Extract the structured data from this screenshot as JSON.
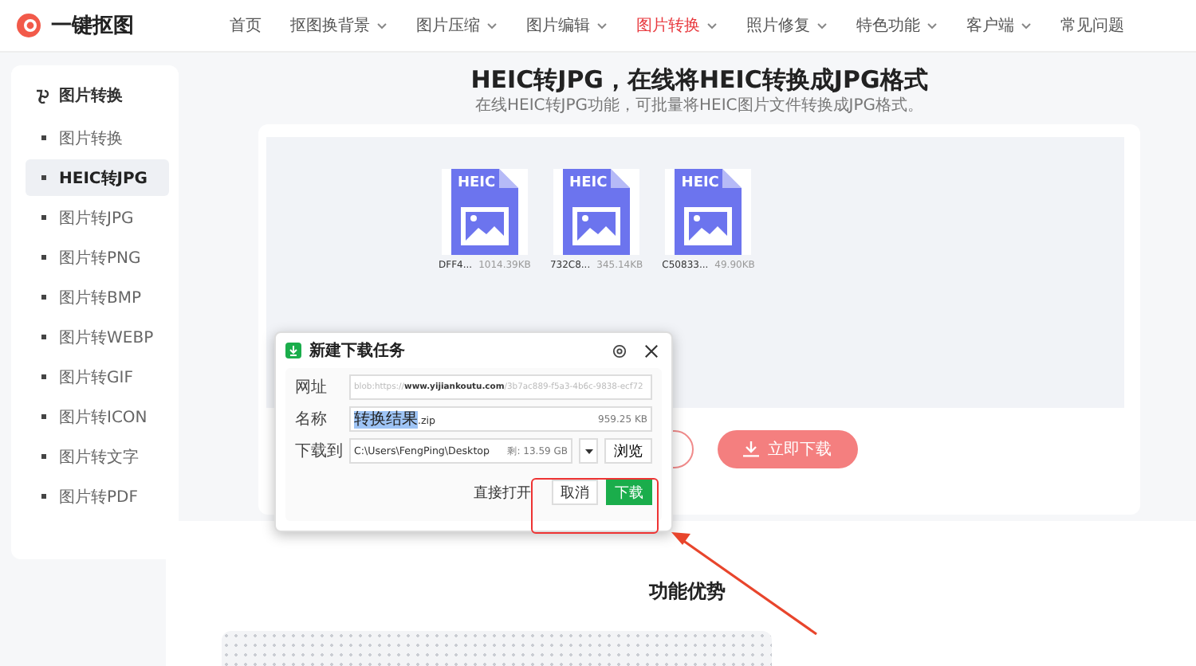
{
  "logo": {
    "text": "一键抠图"
  },
  "nav": [
    {
      "label": "首页",
      "dropdown": false,
      "selected": false
    },
    {
      "label": "抠图换背景",
      "dropdown": true,
      "selected": false
    },
    {
      "label": "图片压缩",
      "dropdown": true,
      "selected": false
    },
    {
      "label": "图片编辑",
      "dropdown": true,
      "selected": false
    },
    {
      "label": "图片转换",
      "dropdown": true,
      "selected": true
    },
    {
      "label": "照片修复",
      "dropdown": true,
      "selected": false
    },
    {
      "label": "特色功能",
      "dropdown": true,
      "selected": false
    },
    {
      "label": "客户端",
      "dropdown": true,
      "selected": false
    },
    {
      "label": "常见问题",
      "dropdown": false,
      "selected": false
    }
  ],
  "sidebar": {
    "title": "图片转换",
    "items": [
      {
        "label": "图片转换",
        "selected": false
      },
      {
        "label": "HEIC转JPG",
        "selected": true
      },
      {
        "label": "图片转JPG",
        "selected": false
      },
      {
        "label": "图片转PNG",
        "selected": false
      },
      {
        "label": "图片转BMP",
        "selected": false
      },
      {
        "label": "图片转WEBP",
        "selected": false
      },
      {
        "label": "图片转GIF",
        "selected": false
      },
      {
        "label": "图片转ICON",
        "selected": false
      },
      {
        "label": "图片转文字",
        "selected": false
      },
      {
        "label": "图片转PDF",
        "selected": false
      }
    ]
  },
  "page": {
    "title": "HEIC转JPG，在线将HEIC转换成JPG格式",
    "subtitle": "在线HEIC转JPG功能，可批量将HEIC图片文件转换成JPG格式。"
  },
  "files": [
    {
      "badge": "HEIC",
      "name": "DFF4...",
      "size": "1014.39KB"
    },
    {
      "badge": "HEIC",
      "name": "732C8...",
      "size": "345.14KB"
    },
    {
      "badge": "HEIC",
      "name": "C50833...",
      "size": "49.90KB"
    }
  ],
  "download_button": "立即下载",
  "dialog": {
    "title": "新建下载任务",
    "rows": [
      {
        "kind": "url",
        "label": "网址",
        "value": "blob:https://**www.yijiankoutu.com**/3b7ac889-f5a3-4b6c-9838-ecf72"
      },
      {
        "kind": "name",
        "label": "名称",
        "selected_text": "转换结果",
        "value": ".zip",
        "size": "959.25 KB"
      },
      {
        "kind": "path",
        "label": "下载到",
        "value": "C:\\Users\\FengPing\\Desktop",
        "free": "剩: 13.59 GB",
        "button": "浏览"
      }
    ],
    "open_link": "直接打开",
    "buttons": [
      {
        "label": "取消",
        "primary": false
      },
      {
        "label": "下载",
        "primary": true
      }
    ]
  },
  "annotation": {
    "caption": "功能优势"
  }
}
